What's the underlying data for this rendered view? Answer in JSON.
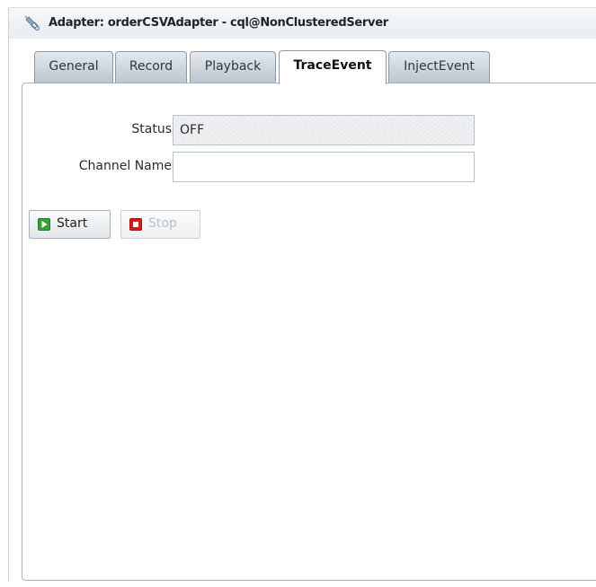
{
  "window": {
    "title": "Adapter: orderCSVAdapter - cql@NonClusteredServer",
    "icon": "adapter-icon"
  },
  "tabs": [
    {
      "label": "General",
      "active": false
    },
    {
      "label": "Record",
      "active": false
    },
    {
      "label": "Playback",
      "active": false
    },
    {
      "label": "TraceEvent",
      "active": true
    },
    {
      "label": "InjectEvent",
      "active": false
    }
  ],
  "form": {
    "status_label": "Status",
    "status_value": "OFF",
    "channel_name_label": "Channel Name",
    "channel_name_value": ""
  },
  "buttons": {
    "start_label": "Start",
    "start_icon": "play-icon",
    "stop_label": "Stop",
    "stop_icon": "stop-icon",
    "stop_enabled": false
  },
  "colors": {
    "start_icon": "#3aa03a",
    "stop_icon": "#d81b1b",
    "tab_border": "#8d9aa6"
  }
}
